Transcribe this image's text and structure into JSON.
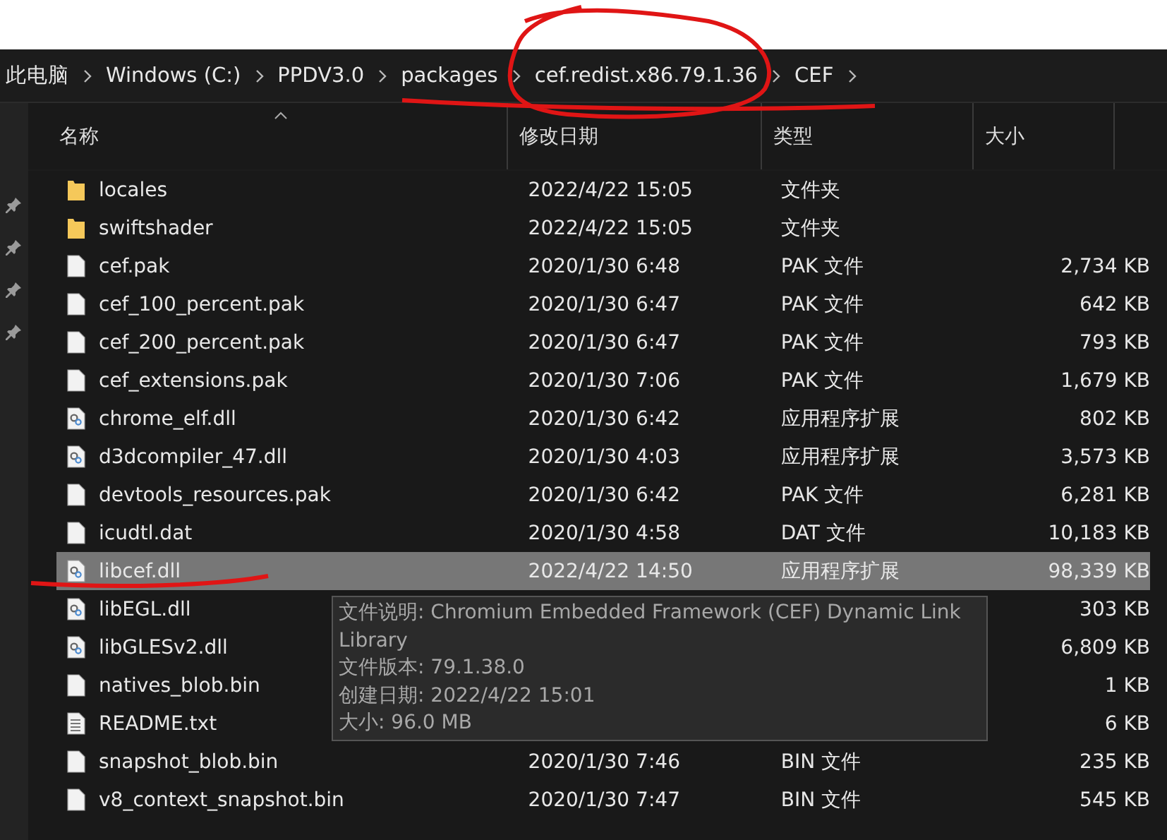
{
  "breadcrumb": [
    "此电脑",
    "Windows (C:)",
    "PPDV3.0",
    "packages",
    "cef.redist.x86.79.1.36",
    "CEF"
  ],
  "columns": [
    "名称",
    "修改日期",
    "类型",
    "大小"
  ],
  "rows": [
    {
      "kind": "folder",
      "name": "locales",
      "date": "2022/4/22 15:05",
      "type": "文件夹",
      "selected": false
    },
    {
      "kind": "folder",
      "name": "swiftshader",
      "date": "2022/4/22 15:05",
      "type": "文件夹",
      "selected": false
    },
    {
      "kind": "file",
      "name": "cef.pak",
      "date": "2020/1/30 6:48",
      "type": "PAK 文件",
      "size": "2,734 KB",
      "selected": false
    },
    {
      "kind": "file",
      "name": "cef_100_percent.pak",
      "date": "2020/1/30 6:47",
      "type": "PAK 文件",
      "size": "642 KB",
      "selected": false
    },
    {
      "kind": "file",
      "name": "cef_200_percent.pak",
      "date": "2020/1/30 6:47",
      "type": "PAK 文件",
      "size": "793 KB",
      "selected": false
    },
    {
      "kind": "file",
      "name": "cef_extensions.pak",
      "date": "2020/1/30 7:06",
      "type": "PAK 文件",
      "size": "1,679 KB",
      "selected": false
    },
    {
      "kind": "dll",
      "name": "chrome_elf.dll",
      "date": "2020/1/30 6:42",
      "type": "应用程序扩展",
      "size": "802 KB",
      "selected": false
    },
    {
      "kind": "dll",
      "name": "d3dcompiler_47.dll",
      "date": "2020/1/30 4:03",
      "type": "应用程序扩展",
      "size": "3,573 KB",
      "selected": false
    },
    {
      "kind": "file",
      "name": "devtools_resources.pak",
      "date": "2020/1/30 6:42",
      "type": "PAK 文件",
      "size": "6,281 KB",
      "selected": false
    },
    {
      "kind": "file",
      "name": "icudtl.dat",
      "date": "2020/1/30 4:58",
      "type": "DAT 文件",
      "size": "10,183 KB",
      "selected": false
    },
    {
      "kind": "dll",
      "name": "libcef.dll",
      "date": "2022/4/22 14:50",
      "type": "应用程序扩展",
      "size": "98,339 KB",
      "selected": true
    },
    {
      "kind": "dll",
      "name": "libEGL.dll",
      "size": "303 KB",
      "selected": false
    },
    {
      "kind": "dll",
      "name": "libGLESv2.dll",
      "size": "6,809 KB",
      "selected": false
    },
    {
      "kind": "file",
      "name": "natives_blob.bin",
      "size": "1 KB",
      "selected": false
    },
    {
      "kind": "text",
      "name": "README.txt",
      "size": "6 KB",
      "selected": false
    },
    {
      "kind": "file",
      "name": "snapshot_blob.bin",
      "date": "2020/1/30 7:46",
      "type": "BIN 文件",
      "size": "235 KB",
      "selected": false
    },
    {
      "kind": "file",
      "name": "v8_context_snapshot.bin",
      "date": "2020/1/30 7:47",
      "type": "BIN 文件",
      "size": "545 KB",
      "selected": false
    }
  ],
  "tooltip": [
    "文件说明: Chromium Embedded Framework (CEF) Dynamic Link Library",
    "文件版本: 79.1.38.0",
    "创建日期: 2022/4/22 15:01",
    "大小: 96.0 MB"
  ]
}
